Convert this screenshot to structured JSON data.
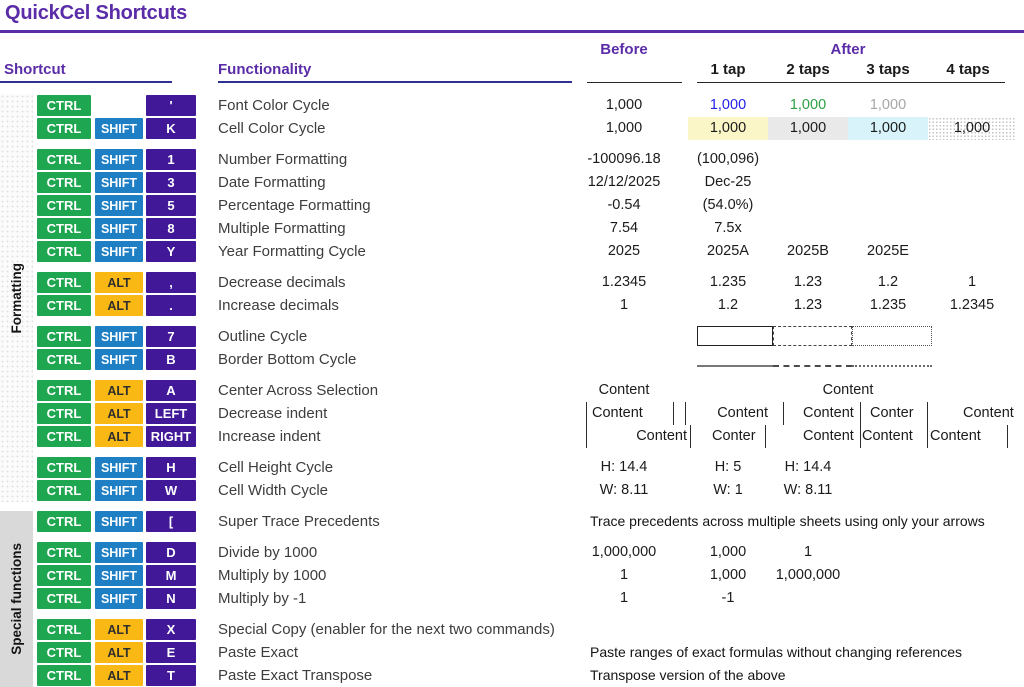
{
  "title": "QuickCel Shortcuts",
  "headers": {
    "shortcut": "Shortcut",
    "functionality": "Functionality",
    "before": "Before",
    "after": "After",
    "taps": [
      "1 tap",
      "2 taps",
      "3 taps",
      "4 taps"
    ]
  },
  "groups": [
    {
      "label": "Formatting"
    },
    {
      "label": "Special functions"
    }
  ],
  "colors": {
    "accent_purple": "#5B2CA8",
    "header_underline_navy": "#2E3192",
    "value_underline_dark": "#262626",
    "ctrl_green": "#1FA650",
    "shift_blue": "#1F7FC5",
    "alt_yellow": "#F9B814",
    "key_purple": "#401898",
    "font_cycle": {
      "tap1_blue": "#2323E8",
      "tap2_green": "#2EA043",
      "tap3_gray": "#A6A6A6"
    },
    "cell_cycle": {
      "tap1_yellow": "#FBF6C8",
      "tap2_gray": "#E9E9E9",
      "tap3_cyan": "#D8F4FA",
      "tap4": "dotted-pattern"
    },
    "group_strip_gray": "#D9D9D9"
  },
  "rows": [
    {
      "keys": [
        "CTRL",
        "",
        "'"
      ],
      "func": "Font Color Cycle",
      "before": "1,000",
      "after": [
        {
          "t": "1,000",
          "color": "tap1_blue"
        },
        {
          "t": "1,000",
          "color": "tap2_green"
        },
        {
          "t": "1,000",
          "color": "tap3_gray"
        },
        null
      ]
    },
    {
      "keys": [
        "CTRL",
        "SHIFT",
        "K"
      ],
      "func": "Cell Color Cycle",
      "before": "1,000",
      "after": [
        {
          "t": "1,000",
          "bg": "tap1_yellow"
        },
        {
          "t": "1,000",
          "bg": "tap2_gray"
        },
        {
          "t": "1,000",
          "bg": "tap3_cyan"
        },
        {
          "t": "1,000",
          "bg": "dots"
        }
      ]
    },
    {
      "sep": true,
      "keys": [
        "CTRL",
        "SHIFT",
        "1"
      ],
      "func": "Number Formatting",
      "before": "-100096.18",
      "after": [
        "(100,096)"
      ]
    },
    {
      "keys": [
        "CTRL",
        "SHIFT",
        "3"
      ],
      "func": "Date Formatting",
      "before": "12/12/2025",
      "after": [
        "Dec-25"
      ]
    },
    {
      "keys": [
        "CTRL",
        "SHIFT",
        "5"
      ],
      "func": "Percentage Formatting",
      "before": "-0.54",
      "after": [
        "(54.0%)"
      ]
    },
    {
      "keys": [
        "CTRL",
        "SHIFT",
        "8"
      ],
      "func": "Multiple Formatting",
      "before": "7.54",
      "after": [
        "7.5x"
      ]
    },
    {
      "keys": [
        "CTRL",
        "SHIFT",
        "Y"
      ],
      "func": "Year Formatting Cycle",
      "before": "2025",
      "after": [
        "2025A",
        "2025B",
        "2025E"
      ]
    },
    {
      "sep": true,
      "keys": [
        "CTRL",
        "ALT",
        ","
      ],
      "func": "Decrease decimals",
      "before": "1.2345",
      "after": [
        "1.235",
        "1.23",
        "1.2",
        "1"
      ]
    },
    {
      "keys": [
        "CTRL",
        "ALT",
        "."
      ],
      "func": "Increase decimals",
      "before": "1",
      "after": [
        "1.2",
        "1.23",
        "1.235",
        "1.2345"
      ]
    },
    {
      "sep": true,
      "keys": [
        "CTRL",
        "SHIFT",
        "7"
      ],
      "func": "Outline Cycle",
      "type": "boxes",
      "box_styles": [
        "solid",
        "dashed",
        "dotted"
      ]
    },
    {
      "keys": [
        "CTRL",
        "SHIFT",
        "B"
      ],
      "func": "Border Bottom Cycle",
      "type": "borders",
      "box_styles": [
        "solid",
        "dashed",
        "dotted"
      ]
    },
    {
      "sep": true,
      "keys": [
        "CTRL",
        "ALT",
        "A"
      ],
      "func": "Center Across Selection",
      "type": "centerAcross",
      "before": "Content",
      "across": "Content"
    },
    {
      "keys": [
        "CTRL",
        "ALT",
        "LEFT"
      ],
      "func": "Decrease indent",
      "type": "indentDec",
      "cells": [
        "Content",
        "Content",
        "Content",
        "Conter",
        "Content"
      ]
    },
    {
      "keys": [
        "CTRL",
        "ALT",
        "RIGHT"
      ],
      "func": "Increase indent",
      "type": "indentInc",
      "cells": [
        "Content",
        "Conter",
        "Content",
        "Content",
        "Content"
      ]
    },
    {
      "sep": true,
      "keys": [
        "CTRL",
        "SHIFT",
        "H"
      ],
      "func": "Cell Height Cycle",
      "before": "H: 14.4",
      "after": [
        "H: 5",
        "H: 14.4"
      ]
    },
    {
      "keys": [
        "CTRL",
        "SHIFT",
        "W"
      ],
      "func": "Cell Width Cycle",
      "before": "W: 8.11",
      "after": [
        "W: 1",
        "W: 8.11"
      ]
    },
    {
      "sep": true,
      "group2": true,
      "keys": [
        "CTRL",
        "SHIFT",
        "["
      ],
      "func": "Super Trace Precedents",
      "type": "note",
      "note": "Trace precedents across multiple sheets using only your arrows"
    },
    {
      "sep": true,
      "keys": [
        "CTRL",
        "SHIFT",
        "D"
      ],
      "func": "Divide by 1000",
      "before": "1,000,000",
      "after": [
        "1,000",
        "1"
      ]
    },
    {
      "keys": [
        "CTRL",
        "SHIFT",
        "M"
      ],
      "func": "Multiply by 1000",
      "before": "1",
      "after": [
        "1,000",
        "1,000,000"
      ]
    },
    {
      "keys": [
        "CTRL",
        "SHIFT",
        "N"
      ],
      "func": "Multiply by -1",
      "before": "1",
      "after": [
        "-1"
      ]
    },
    {
      "sep": true,
      "keys": [
        "CTRL",
        "ALT",
        "X"
      ],
      "func": "Special Copy (enabler for the next two commands)"
    },
    {
      "keys": [
        "CTRL",
        "ALT",
        "E"
      ],
      "func": "Paste Exact",
      "type": "note",
      "note": "Paste ranges of exact formulas without changing references"
    },
    {
      "keys": [
        "CTRL",
        "ALT",
        "T"
      ],
      "func": "Paste Exact Transpose",
      "type": "note",
      "note": "Transpose version of the above"
    }
  ]
}
